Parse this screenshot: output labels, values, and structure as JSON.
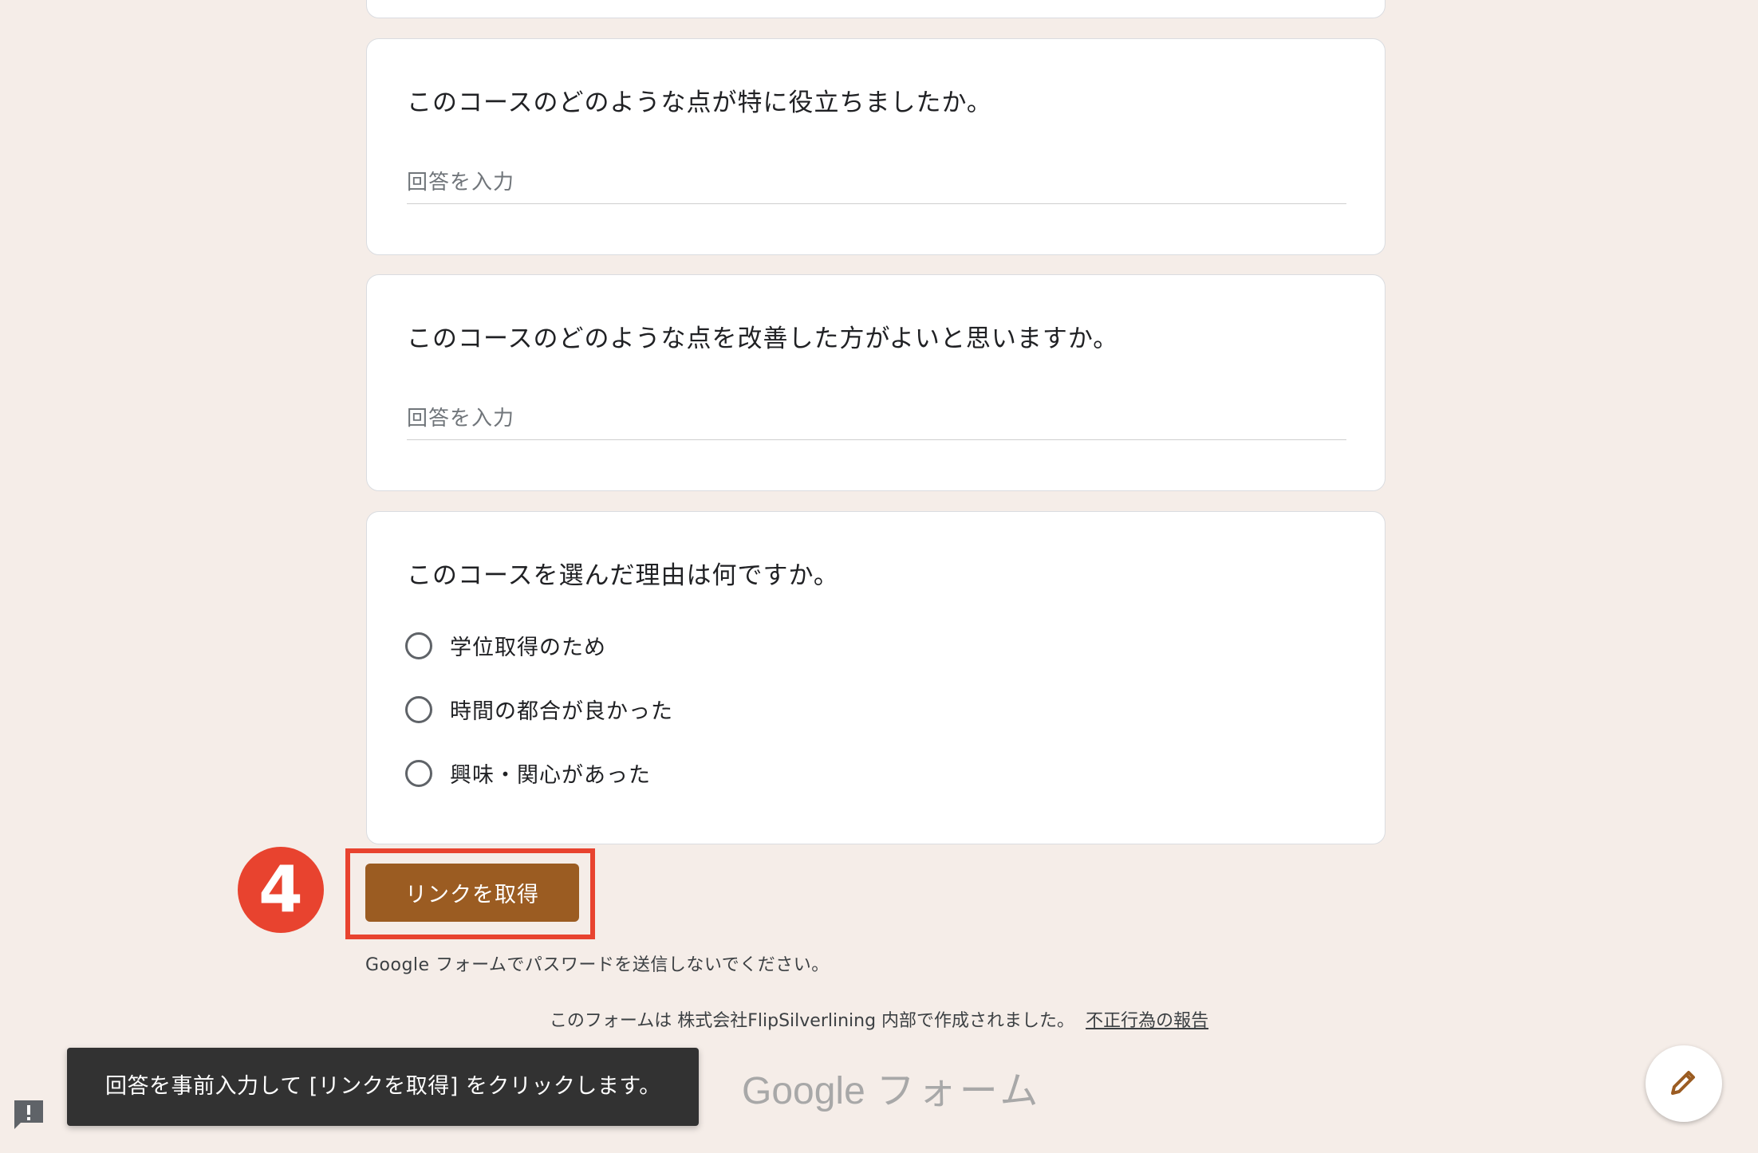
{
  "questions": [
    {
      "title": "このコースのどのような点が特に役立ちましたか。",
      "placeholder": "回答を入力"
    },
    {
      "title": "このコースのどのような点を改善した方がよいと思いますか。",
      "placeholder": "回答を入力"
    },
    {
      "title": "このコースを選んだ理由は何ですか。",
      "options": [
        "学位取得のため",
        "時間の都合が良かった",
        "興味・関心があった"
      ]
    }
  ],
  "step_badge": "4",
  "get_link_button": "リンクを取得",
  "password_warning": "Google フォームでパスワードを送信しないでください。",
  "footer": {
    "note": "このフォームは 株式会社FlipSilverlining 内部で作成されました。",
    "report_link": "不正行為の報告"
  },
  "brand": {
    "google": "Google",
    "forms": "フォーム"
  },
  "snackbar": "回答を事前入力して [リンクを取得] をクリックします。",
  "icons": {
    "feedback": "feedback-icon",
    "edit": "pencil-icon"
  },
  "colors": {
    "background": "#f5ede8",
    "button": "#9b5c22",
    "annotation": "#e8432f",
    "snackbar": "#323232"
  }
}
